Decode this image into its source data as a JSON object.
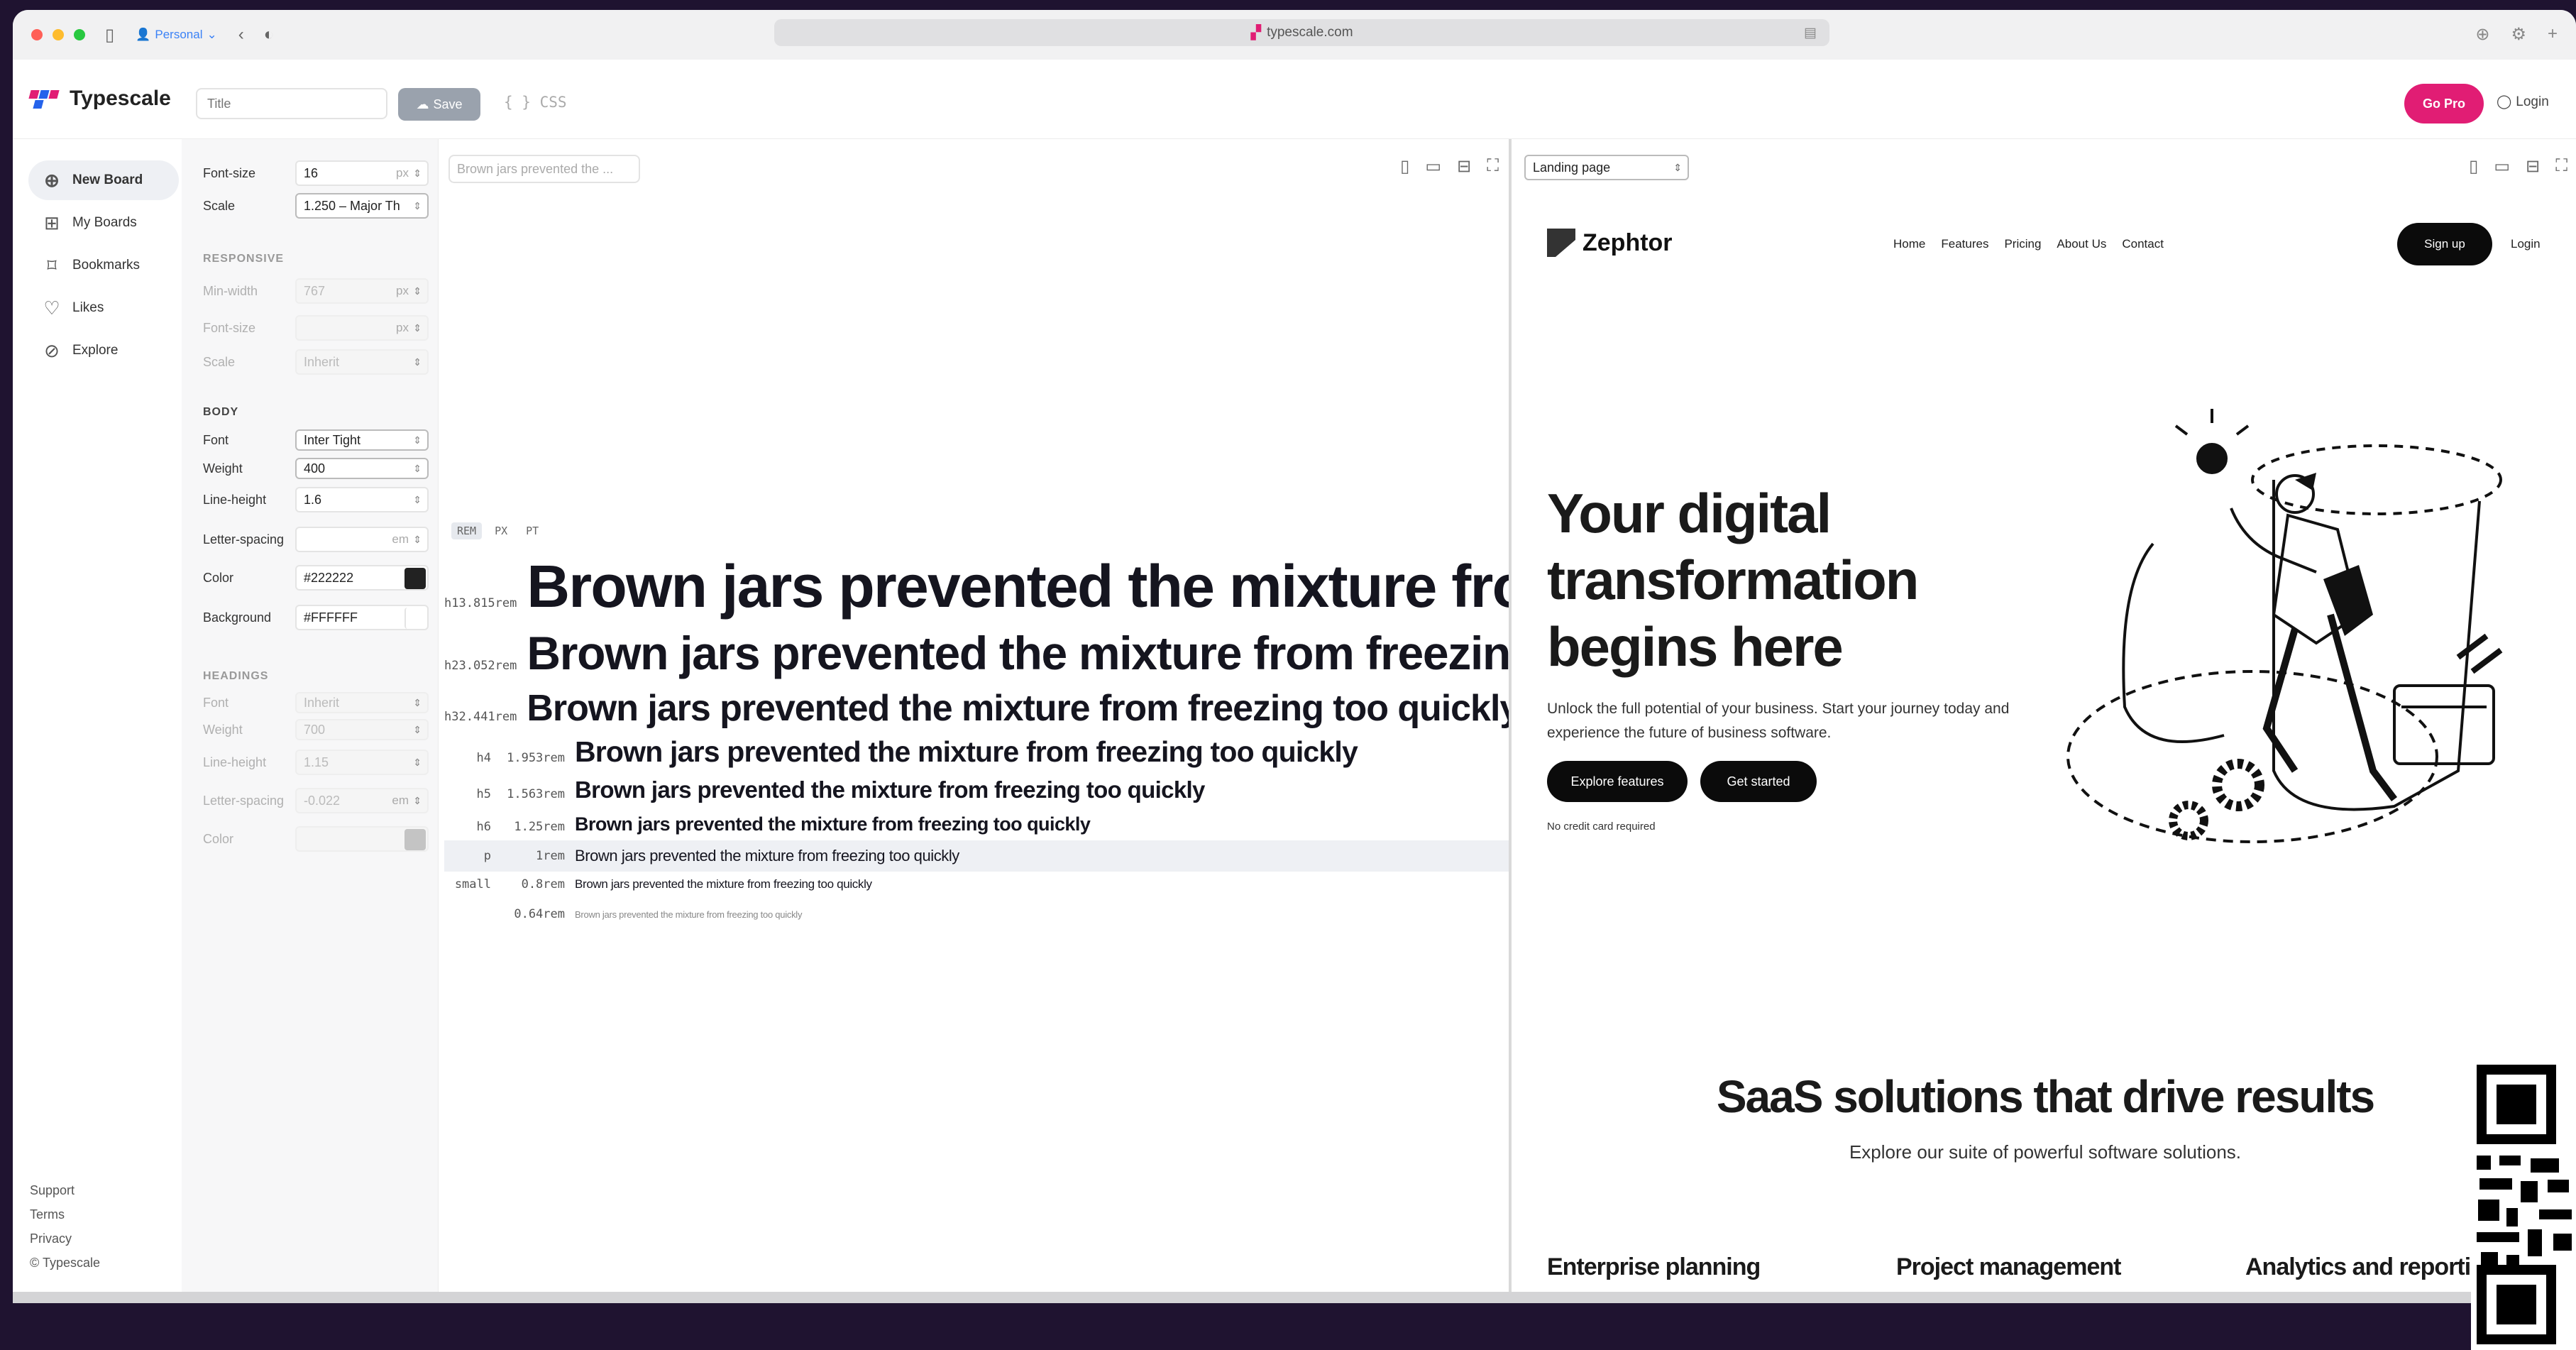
{
  "browser": {
    "profile": "Personal",
    "url": "typescale.com"
  },
  "app": {
    "logo": "Typescale",
    "title_placeholder": "Title",
    "save_label": "Save",
    "css_label": "{ } CSS",
    "gopro_label": "Go Pro",
    "login_label": "Login"
  },
  "nav": {
    "items": [
      {
        "label": "New Board",
        "icon": "plus-circle-icon"
      },
      {
        "label": "My Boards",
        "icon": "grid-icon"
      },
      {
        "label": "Bookmarks",
        "icon": "bookmark-icon"
      },
      {
        "label": "Likes",
        "icon": "heart-icon"
      },
      {
        "label": "Explore",
        "icon": "compass-icon"
      }
    ],
    "footer": [
      "Support",
      "Terms",
      "Privacy",
      "© Typescale"
    ]
  },
  "settings": {
    "font_size_label": "Font-size",
    "font_size_value": "16",
    "font_size_unit": "px",
    "scale_label": "Scale",
    "scale_value": "1.250 – Major Th",
    "responsive": {
      "heading": "RESPONSIVE",
      "min_width_label": "Min-width",
      "min_width_value": "767",
      "min_width_unit": "px",
      "font_size_label": "Font-size",
      "font_size_unit": "px",
      "scale_label": "Scale",
      "scale_value": "Inherit"
    },
    "body": {
      "heading": "BODY",
      "font_label": "Font",
      "font_value": "Inter Tight",
      "weight_label": "Weight",
      "weight_value": "400",
      "line_height_label": "Line-height",
      "line_height_value": "1.6",
      "letter_spacing_label": "Letter-spacing",
      "letter_spacing_unit": "em",
      "color_label": "Color",
      "color_value": "#222222",
      "background_label": "Background",
      "background_value": "#FFFFFF"
    },
    "headings": {
      "heading": "HEADINGS",
      "font_label": "Font",
      "font_value": "Inherit",
      "weight_label": "Weight",
      "weight_value": "700",
      "line_height_label": "Line-height",
      "line_height_value": "1.15",
      "letter_spacing_label": "Letter-spacing",
      "letter_spacing_value": "-0.022",
      "letter_spacing_unit": "em",
      "color_label": "Color"
    }
  },
  "preview": {
    "sample_input": "Brown jars prevented the ...",
    "units": [
      "REM",
      "PX",
      "PT"
    ],
    "active_unit": "REM",
    "scale": [
      {
        "tag": "h1",
        "value": "3.815rem",
        "text": "Brown jars prevented the mixture from freezing too quickly"
      },
      {
        "tag": "h2",
        "value": "3.052rem",
        "text": "Brown jars prevented the mixture from freezing too quickly"
      },
      {
        "tag": "h3",
        "value": "2.441rem",
        "text": "Brown jars prevented the mixture from freezing too quickly"
      },
      {
        "tag": "h4",
        "value": "1.953rem",
        "text": "Brown jars prevented the mixture from freezing too quickly"
      },
      {
        "tag": "h5",
        "value": "1.563rem",
        "text": "Brown jars prevented the mixture from freezing too quickly"
      },
      {
        "tag": "h6",
        "value": "1.25rem",
        "text": "Brown jars prevented the mixture from freezing too quickly"
      },
      {
        "tag": "p",
        "value": "1rem",
        "text": "Brown jars prevented the mixture from freezing too quickly"
      },
      {
        "tag": "small",
        "value": "0.8rem",
        "text": "Brown jars prevented the mixture from freezing too quickly"
      },
      {
        "tag": "",
        "value": "0.64rem",
        "text": "Brown jars prevented the mixture from freezing too quickly"
      }
    ]
  },
  "landing": {
    "template": "Landing page",
    "brand": "Zephtor",
    "nav": [
      "Home",
      "Features",
      "Pricing",
      "About Us",
      "Contact"
    ],
    "signup": "Sign up",
    "login": "Login",
    "hero_title": "Your digital transformation begins here",
    "hero_sub": "Unlock the full potential of your business. Start your journey today and experience the future of business software.",
    "btn_explore": "Explore features",
    "btn_start": "Get started",
    "no_cc": "No credit card required",
    "section_title": "SaaS solutions that drive results",
    "section_sub": "Explore our suite of powerful software solutions.",
    "features": [
      "Enterprise planning",
      "Project management",
      "Analytics and reporting"
    ]
  },
  "colors": {
    "accent": "#e11d74",
    "text": "#222222",
    "background": "#FFFFFF"
  }
}
